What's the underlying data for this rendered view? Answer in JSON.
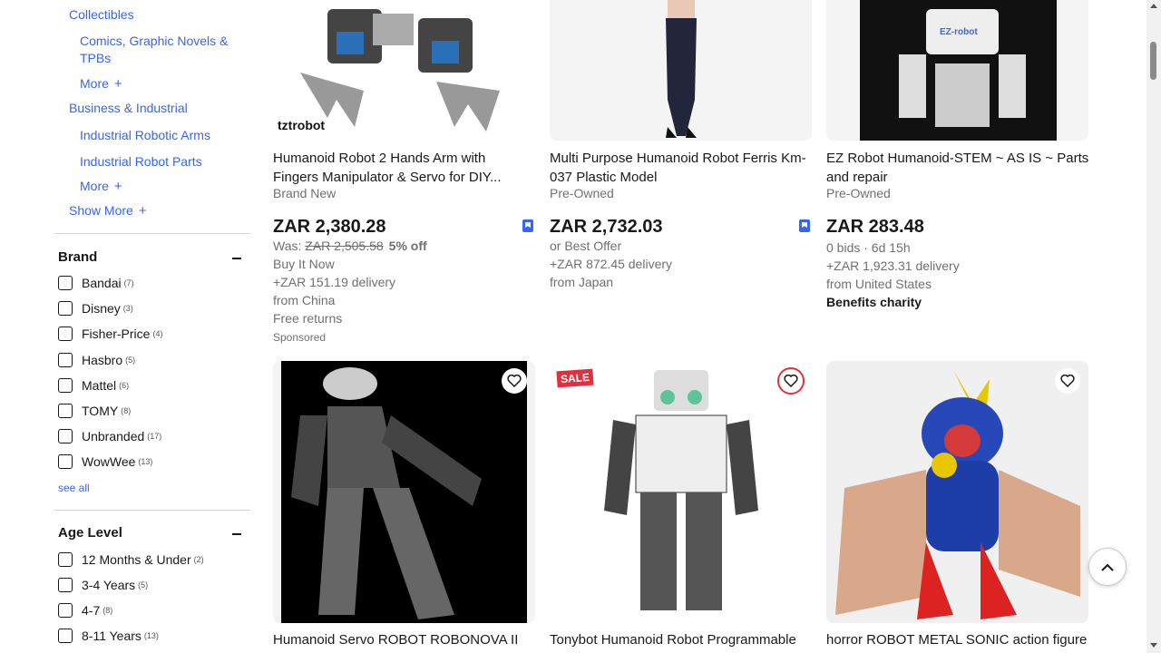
{
  "sidebar": {
    "categories": [
      {
        "label": "Collectibles"
      },
      {
        "label": "Comics, Graphic Novels &"
      },
      {
        "label": "TPBs"
      },
      {
        "label": "More"
      },
      {
        "label": "Business & Industrial"
      },
      {
        "label": "Industrial Robotic Arms"
      },
      {
        "label": "Industrial Robot Parts"
      },
      {
        "label": "More"
      },
      {
        "label": "Show More"
      }
    ],
    "brand": {
      "title": "Brand",
      "items": [
        {
          "label": "Bandai",
          "count": "(7)"
        },
        {
          "label": "Disney",
          "count": "(3)"
        },
        {
          "label": "Fisher-Price",
          "count": "(4)"
        },
        {
          "label": "Hasbro",
          "count": "(5)"
        },
        {
          "label": "Mattel",
          "count": "(6)"
        },
        {
          "label": "TOMY",
          "count": "(8)"
        },
        {
          "label": "Unbranded",
          "count": "(17)"
        },
        {
          "label": "WowWee",
          "count": "(13)"
        }
      ],
      "see_all": "see all"
    },
    "age": {
      "title": "Age Level",
      "items": [
        {
          "label": "12 Months & Under",
          "count": "(2)"
        },
        {
          "label": "3-4 Years",
          "count": "(5)"
        },
        {
          "label": "4-7",
          "count": "(8)"
        },
        {
          "label": "8-11 Years",
          "count": "(13)"
        }
      ]
    }
  },
  "listings": [
    {
      "title_line1": "Humanoid Robot 2 Hands Arm with",
      "title_line2": "Fingers Manipulator & Servo for DIY...",
      "condition": "Brand New",
      "price": "ZAR 2,380.28",
      "was_label": "Was:",
      "was_price": "ZAR 2,505.58",
      "discount": "5% off",
      "format": "Buy It Now",
      "delivery": "+ZAR 151.19 delivery",
      "location": "from China",
      "returns": "Free returns",
      "sponsored": "Sponsored",
      "brand_mark": "tztrobot"
    },
    {
      "title_line1": "Multi Purpose Humanoid Robot Ferris Km-",
      "title_line2": "037 Plastic Model",
      "condition": "Pre-Owned",
      "price": "ZAR 2,732.03",
      "format": "or Best Offer",
      "delivery": "+ZAR 872.45 delivery",
      "location": "from Japan"
    },
    {
      "title_line1": "EZ Robot Humanoid-STEM ~ AS IS ~ Parts",
      "title_line2": "and repair",
      "condition": "Pre-Owned",
      "price": "ZAR 283.48",
      "bids": "0 bids · 6d 15h",
      "delivery": "+ZAR 1,923.31 delivery",
      "location": "from United States",
      "charity": "Benefits charity",
      "brand_mark": "EZ-robot"
    },
    {
      "title_line1": "Humanoid Servo ROBOT ROBONOVA II"
    },
    {
      "title_line1": "Tonybot Humanoid Robot Programmable",
      "badge": "SALE"
    },
    {
      "title_line1": "horror ROBOT METAL SONIC action figure"
    }
  ],
  "colors": {
    "link": "#3665f3",
    "sale": "#e0303e"
  }
}
